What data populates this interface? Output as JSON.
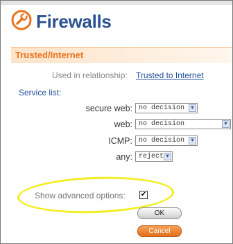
{
  "header": {
    "title": "Firewalls",
    "icon": "wrench-circle-icon",
    "accent": "#e8731f"
  },
  "section": {
    "title": "Trusted/Internet"
  },
  "relationship": {
    "label": "Used in relationship:",
    "link": "Trusted to Internet"
  },
  "service_list": {
    "heading": "Service list:",
    "rows": [
      {
        "label": "secure web:",
        "value": "no decision"
      },
      {
        "label": "web:",
        "value": "no decision"
      },
      {
        "label": "ICMP:",
        "value": "no decision"
      },
      {
        "label": "any:",
        "value": "reject"
      }
    ]
  },
  "advanced": {
    "label": "Show advanced options:",
    "checked": true,
    "check_mark": "✔"
  },
  "buttons": {
    "ok": "OK",
    "cancel": "Cancel"
  },
  "colors": {
    "title": "#2d5291",
    "highlight": "#f2ee22",
    "cancel": "#e8731f"
  }
}
